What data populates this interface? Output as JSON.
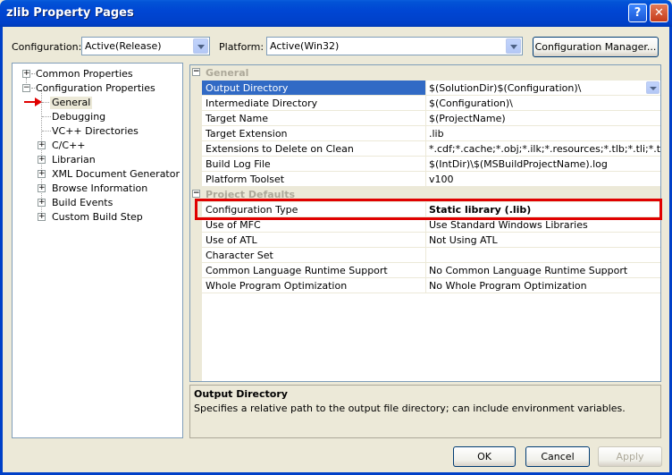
{
  "window": {
    "title": "zlib Property Pages"
  },
  "titlebar_buttons": {
    "help": "?",
    "close": "✕"
  },
  "toolbar": {
    "configuration_label": "Configuration:",
    "configuration_value": "Active(Release)",
    "platform_label": "Platform:",
    "platform_value": "Active(Win32)",
    "config_manager_label": "Configuration Manager..."
  },
  "tree": {
    "common_properties": "Common Properties",
    "configuration_properties": "Configuration Properties",
    "children": [
      "General",
      "Debugging",
      "VC++ Directories",
      "C/C++",
      "Librarian",
      "XML Document Generator",
      "Browse Information",
      "Build Events",
      "Custom Build Step"
    ],
    "selected": "General"
  },
  "grid": {
    "categories": {
      "general": "General",
      "project_defaults": "Project Defaults"
    },
    "general_rows": [
      {
        "name": "Output Directory",
        "value": "$(SolutionDir)$(Configuration)\\"
      },
      {
        "name": "Intermediate Directory",
        "value": "$(Configuration)\\"
      },
      {
        "name": "Target Name",
        "value": "$(ProjectName)"
      },
      {
        "name": "Target Extension",
        "value": ".lib"
      },
      {
        "name": "Extensions to Delete on Clean",
        "value": "*.cdf;*.cache;*.obj;*.ilk;*.resources;*.tlb;*.tli;*.tlh;*.t"
      },
      {
        "name": "Build Log File",
        "value": "$(IntDir)\\$(MSBuildProjectName).log"
      },
      {
        "name": "Platform Toolset",
        "value": "v100"
      }
    ],
    "defaults_rows": [
      {
        "name": "Configuration Type",
        "value": "Static library (.lib)"
      },
      {
        "name": "Use of MFC",
        "value": "Use Standard Windows Libraries"
      },
      {
        "name": "Use of ATL",
        "value": "Not Using ATL"
      },
      {
        "name": "Character Set",
        "value": ""
      },
      {
        "name": "Common Language Runtime Support",
        "value": "No Common Language Runtime Support"
      },
      {
        "name": "Whole Program Optimization",
        "value": "No Whole Program Optimization"
      }
    ]
  },
  "description": {
    "title": "Output Directory",
    "text": "Specifies a relative path to the output file directory; can include environment variables."
  },
  "buttons": {
    "ok": "OK",
    "cancel": "Cancel",
    "apply": "Apply"
  },
  "colors": {
    "highlight": "#e00000",
    "selection": "#316ac5",
    "titlebar": "#0046d3"
  }
}
